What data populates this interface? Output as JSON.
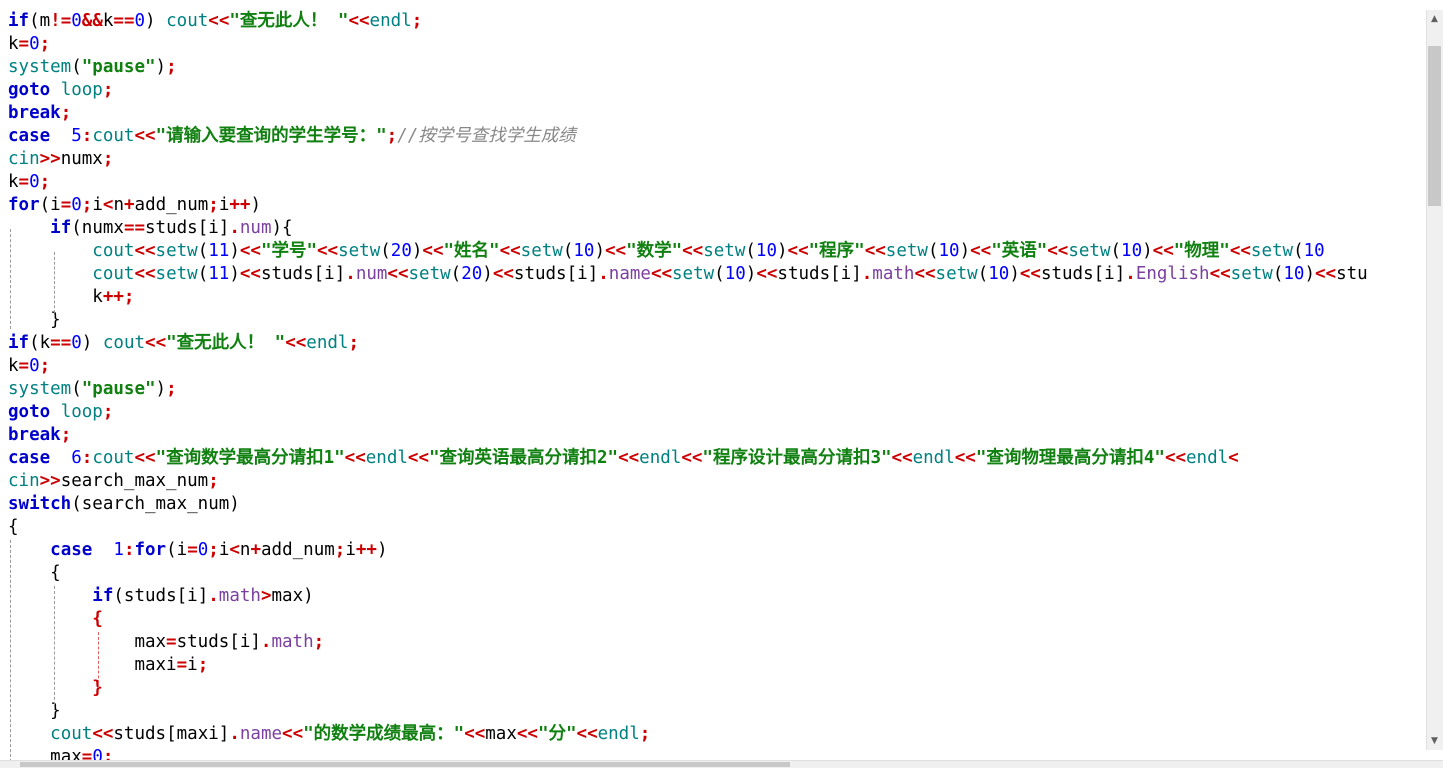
{
  "editor": {
    "lines": [
      [
        [
          "kw",
          "if"
        ],
        [
          "p",
          "("
        ],
        [
          "t",
          "m"
        ],
        [
          "op",
          "!="
        ],
        [
          "num",
          "0"
        ],
        [
          "op",
          "&&"
        ],
        [
          "t",
          "k"
        ],
        [
          "op",
          "=="
        ],
        [
          "num",
          "0"
        ],
        [
          "p",
          ") "
        ],
        [
          "fn",
          "cout"
        ],
        [
          "op",
          "<<"
        ],
        [
          "str",
          "\"查无此人！ \""
        ],
        [
          "op",
          "<<"
        ],
        [
          "fn",
          "endl"
        ],
        [
          "op",
          ";"
        ]
      ],
      [
        [
          "t",
          "k"
        ],
        [
          "op",
          "="
        ],
        [
          "num",
          "0"
        ],
        [
          "op",
          ";"
        ]
      ],
      [
        [
          "fn",
          "system"
        ],
        [
          "p",
          "("
        ],
        [
          "str",
          "\"pause\""
        ],
        [
          "p",
          ")"
        ],
        [
          "op",
          ";"
        ]
      ],
      [
        [
          "kw",
          "goto"
        ],
        [
          "t",
          " "
        ],
        [
          "fn",
          "loop"
        ],
        [
          "op",
          ";"
        ]
      ],
      [
        [
          "kw",
          "break"
        ],
        [
          "op",
          ";"
        ]
      ],
      [
        [
          "kw",
          "case"
        ],
        [
          "t",
          "  "
        ],
        [
          "num",
          "5"
        ],
        [
          "op",
          ":"
        ],
        [
          "fn",
          "cout"
        ],
        [
          "op",
          "<<"
        ],
        [
          "str",
          "\"请输入要查询的学生学号：\""
        ],
        [
          "op",
          ";"
        ],
        [
          "cmt",
          "//按学号查找学生成绩"
        ]
      ],
      [
        [
          "fn",
          "cin"
        ],
        [
          "op",
          ">>"
        ],
        [
          "t",
          "numx"
        ],
        [
          "op",
          ";"
        ]
      ],
      [
        [
          "t",
          "k"
        ],
        [
          "op",
          "="
        ],
        [
          "num",
          "0"
        ],
        [
          "op",
          ";"
        ]
      ],
      [
        [
          "kw",
          "for"
        ],
        [
          "p",
          "("
        ],
        [
          "t",
          "i"
        ],
        [
          "op",
          "="
        ],
        [
          "num",
          "0"
        ],
        [
          "op",
          ";"
        ],
        [
          "t",
          "i"
        ],
        [
          "op",
          "<"
        ],
        [
          "t",
          "n"
        ],
        [
          "op",
          "+"
        ],
        [
          "t",
          "add_num"
        ],
        [
          "op",
          ";"
        ],
        [
          "t",
          "i"
        ],
        [
          "op",
          "++"
        ],
        [
          "p",
          ")"
        ]
      ],
      [
        [
          "t",
          "    "
        ],
        [
          "kw",
          "if"
        ],
        [
          "p",
          "("
        ],
        [
          "t",
          "numx"
        ],
        [
          "op",
          "=="
        ],
        [
          "t",
          "studs"
        ],
        [
          "p",
          "["
        ],
        [
          "t",
          "i"
        ],
        [
          "p",
          "]"
        ],
        [
          "op",
          "."
        ],
        [
          "mem",
          "num"
        ],
        [
          "p",
          "){"
        ]
      ],
      [
        [
          "t",
          "        "
        ],
        [
          "fn",
          "cout"
        ],
        [
          "op",
          "<<"
        ],
        [
          "fn",
          "setw"
        ],
        [
          "p",
          "("
        ],
        [
          "num",
          "11"
        ],
        [
          "p",
          ")"
        ],
        [
          "op",
          "<<"
        ],
        [
          "str",
          "\"学号\""
        ],
        [
          "op",
          "<<"
        ],
        [
          "fn",
          "setw"
        ],
        [
          "p",
          "("
        ],
        [
          "num",
          "20"
        ],
        [
          "p",
          ")"
        ],
        [
          "op",
          "<<"
        ],
        [
          "str",
          "\"姓名\""
        ],
        [
          "op",
          "<<"
        ],
        [
          "fn",
          "setw"
        ],
        [
          "p",
          "("
        ],
        [
          "num",
          "10"
        ],
        [
          "p",
          ")"
        ],
        [
          "op",
          "<<"
        ],
        [
          "str",
          "\"数学\""
        ],
        [
          "op",
          "<<"
        ],
        [
          "fn",
          "setw"
        ],
        [
          "p",
          "("
        ],
        [
          "num",
          "10"
        ],
        [
          "p",
          ")"
        ],
        [
          "op",
          "<<"
        ],
        [
          "str",
          "\"程序\""
        ],
        [
          "op",
          "<<"
        ],
        [
          "fn",
          "setw"
        ],
        [
          "p",
          "("
        ],
        [
          "num",
          "10"
        ],
        [
          "p",
          ")"
        ],
        [
          "op",
          "<<"
        ],
        [
          "str",
          "\"英语\""
        ],
        [
          "op",
          "<<"
        ],
        [
          "fn",
          "setw"
        ],
        [
          "p",
          "("
        ],
        [
          "num",
          "10"
        ],
        [
          "p",
          ")"
        ],
        [
          "op",
          "<<"
        ],
        [
          "str",
          "\"物理\""
        ],
        [
          "op",
          "<<"
        ],
        [
          "fn",
          "setw"
        ],
        [
          "p",
          "("
        ],
        [
          "num",
          "10"
        ]
      ],
      [
        [
          "t",
          "        "
        ],
        [
          "fn",
          "cout"
        ],
        [
          "op",
          "<<"
        ],
        [
          "fn",
          "setw"
        ],
        [
          "p",
          "("
        ],
        [
          "num",
          "11"
        ],
        [
          "p",
          ")"
        ],
        [
          "op",
          "<<"
        ],
        [
          "t",
          "studs"
        ],
        [
          "p",
          "["
        ],
        [
          "t",
          "i"
        ],
        [
          "p",
          "]"
        ],
        [
          "op",
          "."
        ],
        [
          "mem",
          "num"
        ],
        [
          "op",
          "<<"
        ],
        [
          "fn",
          "setw"
        ],
        [
          "p",
          "("
        ],
        [
          "num",
          "20"
        ],
        [
          "p",
          ")"
        ],
        [
          "op",
          "<<"
        ],
        [
          "t",
          "studs"
        ],
        [
          "p",
          "["
        ],
        [
          "t",
          "i"
        ],
        [
          "p",
          "]"
        ],
        [
          "op",
          "."
        ],
        [
          "mem",
          "name"
        ],
        [
          "op",
          "<<"
        ],
        [
          "fn",
          "setw"
        ],
        [
          "p",
          "("
        ],
        [
          "num",
          "10"
        ],
        [
          "p",
          ")"
        ],
        [
          "op",
          "<<"
        ],
        [
          "t",
          "studs"
        ],
        [
          "p",
          "["
        ],
        [
          "t",
          "i"
        ],
        [
          "p",
          "]"
        ],
        [
          "op",
          "."
        ],
        [
          "mem",
          "math"
        ],
        [
          "op",
          "<<"
        ],
        [
          "fn",
          "setw"
        ],
        [
          "p",
          "("
        ],
        [
          "num",
          "10"
        ],
        [
          "p",
          ")"
        ],
        [
          "op",
          "<<"
        ],
        [
          "t",
          "studs"
        ],
        [
          "p",
          "["
        ],
        [
          "t",
          "i"
        ],
        [
          "p",
          "]"
        ],
        [
          "op",
          "."
        ],
        [
          "mem",
          "English"
        ],
        [
          "op",
          "<<"
        ],
        [
          "fn",
          "setw"
        ],
        [
          "p",
          "("
        ],
        [
          "num",
          "10"
        ],
        [
          "p",
          ")"
        ],
        [
          "op",
          "<<"
        ],
        [
          "t",
          "stu"
        ]
      ],
      [
        [
          "t",
          "        "
        ],
        [
          "t",
          "k"
        ],
        [
          "op",
          "++"
        ],
        [
          "op",
          ";"
        ]
      ],
      [
        [
          "t",
          "    "
        ],
        [
          "p",
          "}"
        ]
      ],
      [
        [
          "kw",
          "if"
        ],
        [
          "p",
          "("
        ],
        [
          "t",
          "k"
        ],
        [
          "op",
          "=="
        ],
        [
          "num",
          "0"
        ],
        [
          "p",
          ") "
        ],
        [
          "fn",
          "cout"
        ],
        [
          "op",
          "<<"
        ],
        [
          "str",
          "\"查无此人！ \""
        ],
        [
          "op",
          "<<"
        ],
        [
          "fn",
          "endl"
        ],
        [
          "op",
          ";"
        ]
      ],
      [
        [
          "t",
          "k"
        ],
        [
          "op",
          "="
        ],
        [
          "num",
          "0"
        ],
        [
          "op",
          ";"
        ]
      ],
      [
        [
          "fn",
          "system"
        ],
        [
          "p",
          "("
        ],
        [
          "str",
          "\"pause\""
        ],
        [
          "p",
          ")"
        ],
        [
          "op",
          ";"
        ]
      ],
      [
        [
          "kw",
          "goto"
        ],
        [
          "t",
          " "
        ],
        [
          "fn",
          "loop"
        ],
        [
          "op",
          ";"
        ]
      ],
      [
        [
          "kw",
          "break"
        ],
        [
          "op",
          ";"
        ]
      ],
      [
        [
          "kw",
          "case"
        ],
        [
          "t",
          "  "
        ],
        [
          "num",
          "6"
        ],
        [
          "op",
          ":"
        ],
        [
          "fn",
          "cout"
        ],
        [
          "op",
          "<<"
        ],
        [
          "str",
          "\"查询数学最高分请扣1\""
        ],
        [
          "op",
          "<<"
        ],
        [
          "fn",
          "endl"
        ],
        [
          "op",
          "<<"
        ],
        [
          "str",
          "\"查询英语最高分请扣2\""
        ],
        [
          "op",
          "<<"
        ],
        [
          "fn",
          "endl"
        ],
        [
          "op",
          "<<"
        ],
        [
          "str",
          "\"程序设计最高分请扣3\""
        ],
        [
          "op",
          "<<"
        ],
        [
          "fn",
          "endl"
        ],
        [
          "op",
          "<<"
        ],
        [
          "str",
          "\"查询物理最高分请扣4\""
        ],
        [
          "op",
          "<<"
        ],
        [
          "fn",
          "endl"
        ],
        [
          "op",
          "<"
        ]
      ],
      [
        [
          "fn",
          "cin"
        ],
        [
          "op",
          ">>"
        ],
        [
          "t",
          "search_max_num"
        ],
        [
          "op",
          ";"
        ]
      ],
      [
        [
          "kw",
          "switch"
        ],
        [
          "p",
          "("
        ],
        [
          "t",
          "search_max_num"
        ],
        [
          "p",
          ")"
        ]
      ],
      [
        [
          "p",
          "{"
        ]
      ],
      [
        [
          "t",
          "    "
        ],
        [
          "kw",
          "case"
        ],
        [
          "t",
          "  "
        ],
        [
          "num",
          "1"
        ],
        [
          "op",
          ":"
        ],
        [
          "kw",
          "for"
        ],
        [
          "p",
          "("
        ],
        [
          "t",
          "i"
        ],
        [
          "op",
          "="
        ],
        [
          "num",
          "0"
        ],
        [
          "op",
          ";"
        ],
        [
          "t",
          "i"
        ],
        [
          "op",
          "<"
        ],
        [
          "t",
          "n"
        ],
        [
          "op",
          "+"
        ],
        [
          "t",
          "add_num"
        ],
        [
          "op",
          ";"
        ],
        [
          "t",
          "i"
        ],
        [
          "op",
          "++"
        ],
        [
          "p",
          ")"
        ]
      ],
      [
        [
          "t",
          "    "
        ],
        [
          "p",
          "{"
        ]
      ],
      [
        [
          "t",
          "        "
        ],
        [
          "kw",
          "if"
        ],
        [
          "p",
          "("
        ],
        [
          "t",
          "studs"
        ],
        [
          "p",
          "["
        ],
        [
          "t",
          "i"
        ],
        [
          "p",
          "]"
        ],
        [
          "op",
          "."
        ],
        [
          "mem",
          "math"
        ],
        [
          "op",
          ">"
        ],
        [
          "t",
          "max"
        ],
        [
          "p",
          ")"
        ]
      ],
      [
        [
          "t",
          "        "
        ],
        [
          "op",
          "{"
        ]
      ],
      [
        [
          "t",
          "            "
        ],
        [
          "t",
          "max"
        ],
        [
          "op",
          "="
        ],
        [
          "t",
          "studs"
        ],
        [
          "p",
          "["
        ],
        [
          "t",
          "i"
        ],
        [
          "p",
          "]"
        ],
        [
          "op",
          "."
        ],
        [
          "mem",
          "math"
        ],
        [
          "op",
          ";"
        ]
      ],
      [
        [
          "t",
          "            "
        ],
        [
          "t",
          "maxi"
        ],
        [
          "op",
          "="
        ],
        [
          "t",
          "i"
        ],
        [
          "op",
          ";"
        ]
      ],
      [
        [
          "t",
          "        "
        ],
        [
          "op",
          "}"
        ]
      ],
      [
        [
          "t",
          "    "
        ],
        [
          "p",
          "}"
        ]
      ],
      [
        [
          "t",
          "    "
        ],
        [
          "fn",
          "cout"
        ],
        [
          "op",
          "<<"
        ],
        [
          "t",
          "studs"
        ],
        [
          "p",
          "["
        ],
        [
          "t",
          "maxi"
        ],
        [
          "p",
          "]"
        ],
        [
          "op",
          "."
        ],
        [
          "mem",
          "name"
        ],
        [
          "op",
          "<<"
        ],
        [
          "str",
          "\"的数学成绩最高：\""
        ],
        [
          "op",
          "<<"
        ],
        [
          "t",
          "max"
        ],
        [
          "op",
          "<<"
        ],
        [
          "str",
          "\"分\""
        ],
        [
          "op",
          "<<"
        ],
        [
          "fn",
          "endl"
        ],
        [
          "op",
          ";"
        ]
      ],
      [
        [
          "t",
          "    "
        ],
        [
          "t",
          "max"
        ],
        [
          "op",
          "="
        ],
        [
          "num",
          "0"
        ],
        [
          "op",
          ";"
        ]
      ]
    ]
  },
  "colors": {
    "keyword": "#0000cc",
    "function": "#008080",
    "number": "#0000ff",
    "string": "#108010",
    "operator": "#cc0000",
    "member": "#7b3fa0",
    "comment": "#888888"
  }
}
